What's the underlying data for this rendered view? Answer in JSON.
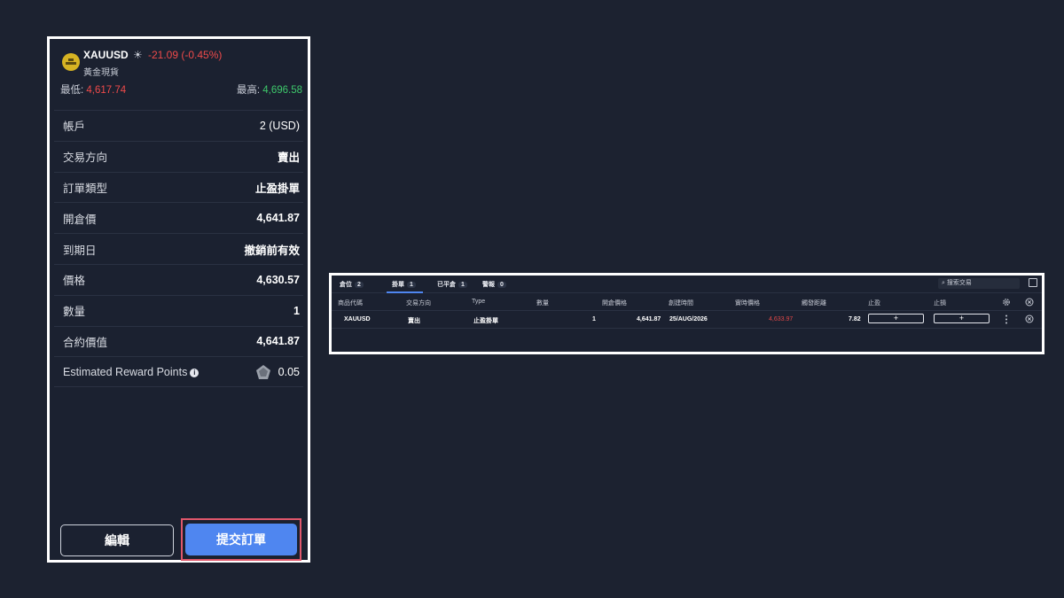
{
  "order_panel": {
    "symbol": "XAUUSD",
    "change": "-21.09  (-0.45%)",
    "subtitle": "黃金現貨",
    "low_label": "最低: ",
    "low_value": "4,617.74",
    "high_label": "最高: ",
    "high_value": "4,696.58",
    "rows": [
      {
        "label": "帳戶",
        "value": "2 (USD)"
      },
      {
        "label": "交易方向",
        "value": "賣出"
      },
      {
        "label": "訂單類型",
        "value": "止盈掛單"
      },
      {
        "label": "開倉價",
        "value": "4,641.87"
      },
      {
        "label": "到期日",
        "value": "撤銷前有效"
      },
      {
        "label": "價格",
        "value": "4,630.57"
      },
      {
        "label": "數量",
        "value": "1"
      },
      {
        "label": "合約價值",
        "value": "4,641.87"
      }
    ],
    "reward": {
      "label": "Estimated Reward Points",
      "value": "0.05"
    },
    "edit_label": "編輯",
    "submit_label": "提交訂單",
    "colors": {
      "down": "#ef4a4a",
      "up": "#3ec96b",
      "accent": "#4f86f0"
    }
  },
  "orders_table": {
    "tabs": [
      {
        "label": "倉位",
        "count": "2"
      },
      {
        "label": "掛單",
        "count": "1"
      },
      {
        "label": "已平倉",
        "count": "1"
      },
      {
        "label": "警報",
        "count": "0"
      }
    ],
    "search_placeholder": "搜索交易",
    "headers": [
      "商品代碼",
      "交易方向",
      "Type",
      "數量",
      "開倉價格",
      "創建時間",
      "實時價格",
      "觸發距離",
      "止盈",
      "止損"
    ],
    "row": {
      "symbol": "XAUUSD",
      "side": "賣出",
      "type": "止盈掛單",
      "qty": "1",
      "open_price": "4,641.87",
      "created": "25/AUG/2026",
      "live_price": "4,633.97",
      "distance": "7.82",
      "tp_btn": "+",
      "sl_btn": "+"
    },
    "icons": [
      "gear-icon",
      "close-circle-icon",
      "more-vertical-icon",
      "expand-icon"
    ]
  }
}
